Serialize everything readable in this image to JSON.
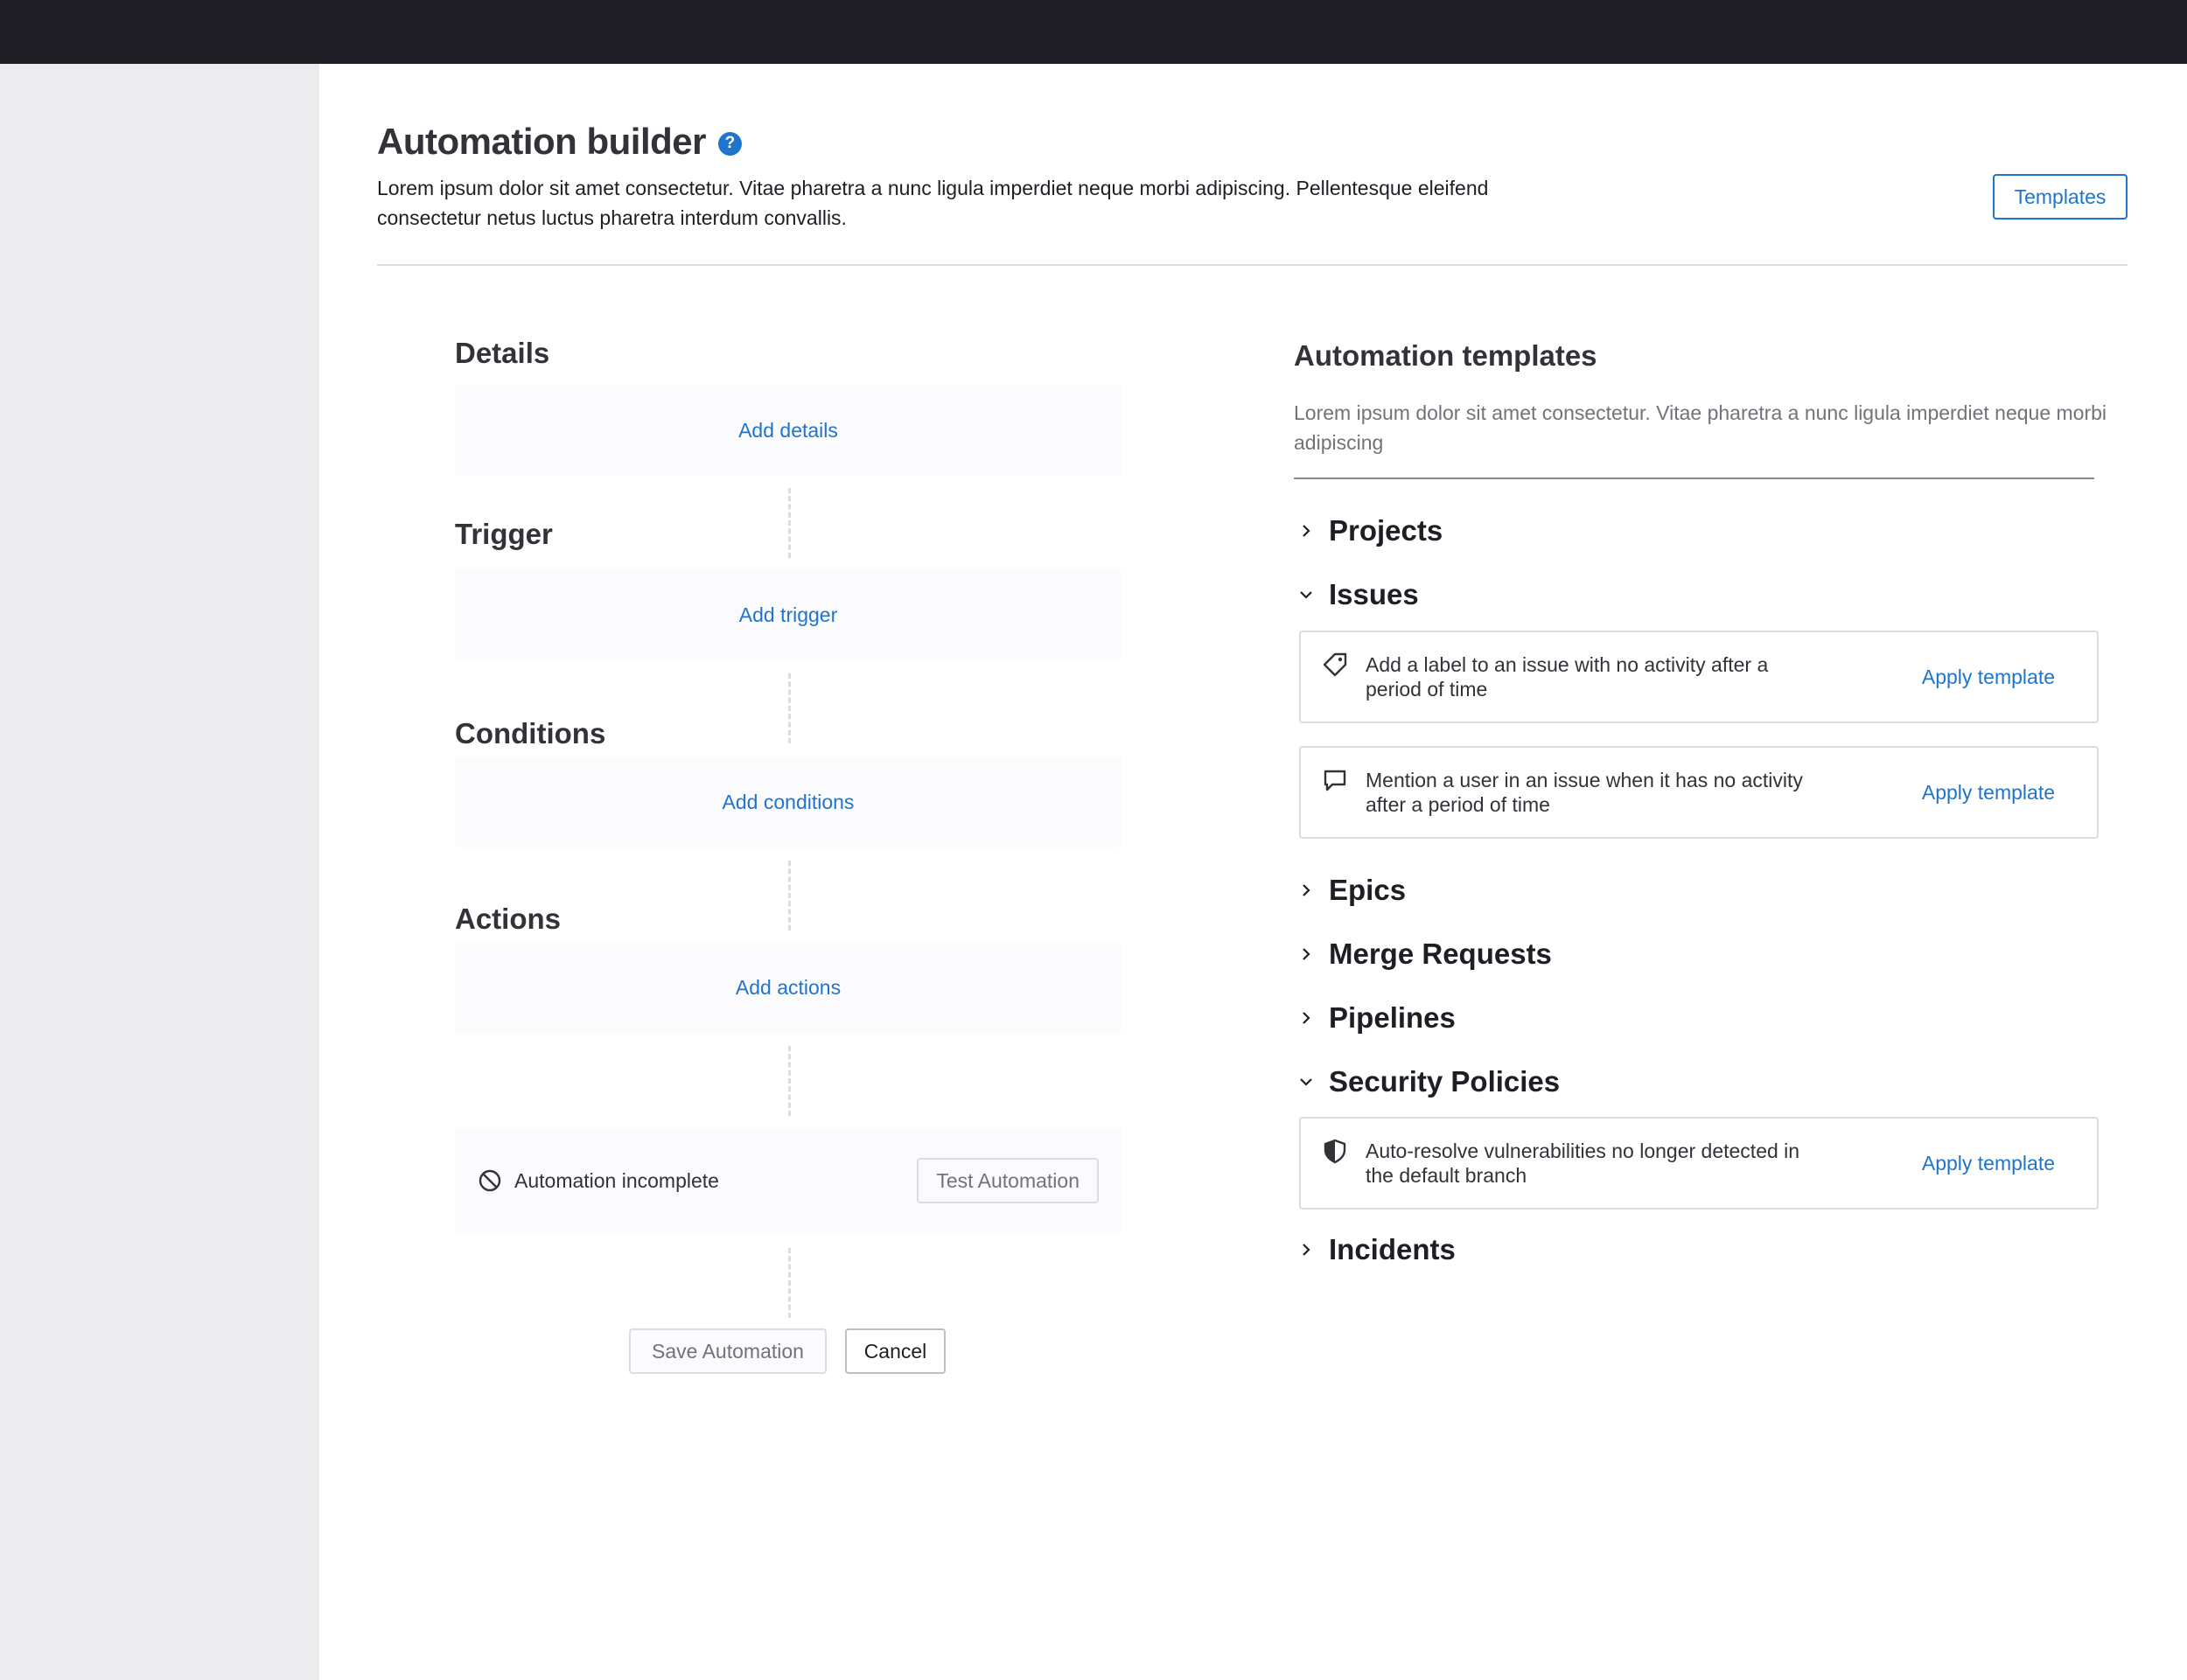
{
  "page": {
    "title": "Automation builder",
    "description": "Lorem ipsum dolor sit amet consectetur. Vitae pharetra a nunc ligula imperdiet neque morbi adipiscing. Pellentesque eleifend consectetur netus luctus pharetra interdum convallis.",
    "templates_button": "Templates"
  },
  "builder": {
    "sections": [
      {
        "title": "Details",
        "link": "Add details"
      },
      {
        "title": "Trigger",
        "link": "Add trigger"
      },
      {
        "title": "Conditions",
        "link": "Add conditions"
      },
      {
        "title": "Actions",
        "link": "Add actions"
      }
    ],
    "status": "Automation incomplete",
    "test_button": "Test Automation",
    "save_button": "Save Automation",
    "cancel_button": "Cancel"
  },
  "templates": {
    "title": "Automation templates",
    "description": "Lorem ipsum dolor sit amet consectetur. Vitae pharetra a nunc ligula imperdiet neque morbi adipiscing",
    "apply_label": "Apply template",
    "categories": [
      {
        "label": "Projects",
        "expanded": false
      },
      {
        "label": "Issues",
        "expanded": true
      },
      {
        "label": "Epics",
        "expanded": false
      },
      {
        "label": "Merge Requests",
        "expanded": false
      },
      {
        "label": "Pipelines",
        "expanded": false
      },
      {
        "label": "Security Policies",
        "expanded": true
      },
      {
        "label": "Incidents",
        "expanded": false
      }
    ],
    "cards": [
      {
        "icon": "label-icon",
        "text": "Add a label to an issue with no activity after a period of time"
      },
      {
        "icon": "comment-icon",
        "text": "Mention a user in an issue when it has no activity after a period of time"
      },
      {
        "icon": "shield-icon",
        "text": "Auto-resolve vulnerabilities no longer detected in the default branch"
      }
    ]
  }
}
